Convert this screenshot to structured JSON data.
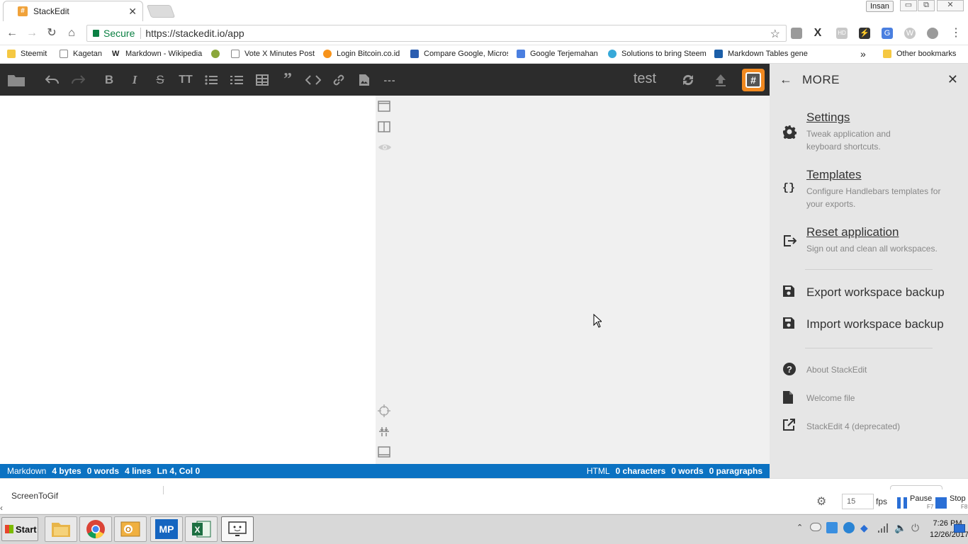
{
  "browser": {
    "tab_title": "StackEdit",
    "tab_icon": "#",
    "user_badge": "Insan",
    "window_min": "▭",
    "window_restore": "⧉",
    "window_close": "✕",
    "secure_label": "Secure",
    "url": "https://stackedit.io/app",
    "bookmarks": [
      {
        "label": "Steemit",
        "icon": "folder-icon"
      },
      {
        "label": "Kagetan",
        "icon": "page-icon"
      },
      {
        "label": "Markdown - Wikipedia",
        "icon": "wikipedia-icon"
      },
      {
        "label": "",
        "icon": "green-circle-icon"
      },
      {
        "label": "Vote X Minutes Post",
        "icon": "page-icon"
      },
      {
        "label": "Login Bitcoin.co.id",
        "icon": "bitcoin-icon"
      },
      {
        "label": "Compare Google, Micros",
        "icon": "shield-icon"
      },
      {
        "label": "Google Terjemahan",
        "icon": "translate-icon"
      },
      {
        "label": "Solutions to bring Steem",
        "icon": "steem-icon"
      },
      {
        "label": "Markdown Tables gene",
        "icon": "table-icon"
      }
    ],
    "bookmarks_overflow": "»",
    "other_bookmarks": "Other bookmarks"
  },
  "app": {
    "doc_title": "test",
    "stack_icon": "#",
    "statusbar": {
      "left": {
        "mode": "Markdown",
        "bytes": "4 bytes",
        "words": "0 words",
        "lines": "4 lines",
        "cursor": "Ln 4, Col 0"
      },
      "right": {
        "mode": "HTML",
        "chars": "0 characters",
        "words": "0 words",
        "paragraphs": "0 paragraphs"
      }
    }
  },
  "panel": {
    "title": "MORE",
    "items": [
      {
        "label": "Settings",
        "desc": "Tweak application and keyboard shortcuts."
      },
      {
        "label": "Templates",
        "desc": "Configure Handlebars templates for your exports."
      },
      {
        "label": "Reset application",
        "desc": "Sign out and clean all workspaces."
      }
    ],
    "actions": [
      "Export workspace backup",
      "Import workspace backup"
    ],
    "links": [
      "About StackEdit",
      "Welcome file",
      "StackEdit 4 (deprecated)"
    ]
  },
  "screentogif": {
    "title": "ScreenToGif",
    "fps_value": "15",
    "fps_label": "fps",
    "pause": "Pause",
    "pause_key": "F7",
    "stop": "Stop",
    "stop_key": "F8"
  },
  "taskbar": {
    "start": "Start",
    "time": "7:26 PM",
    "date": "12/26/2017",
    "mp_label": "MP"
  },
  "colors": {
    "toolbar": "#2c2c2c",
    "statusbar": "#0b72c2",
    "accent": "#f18920"
  }
}
